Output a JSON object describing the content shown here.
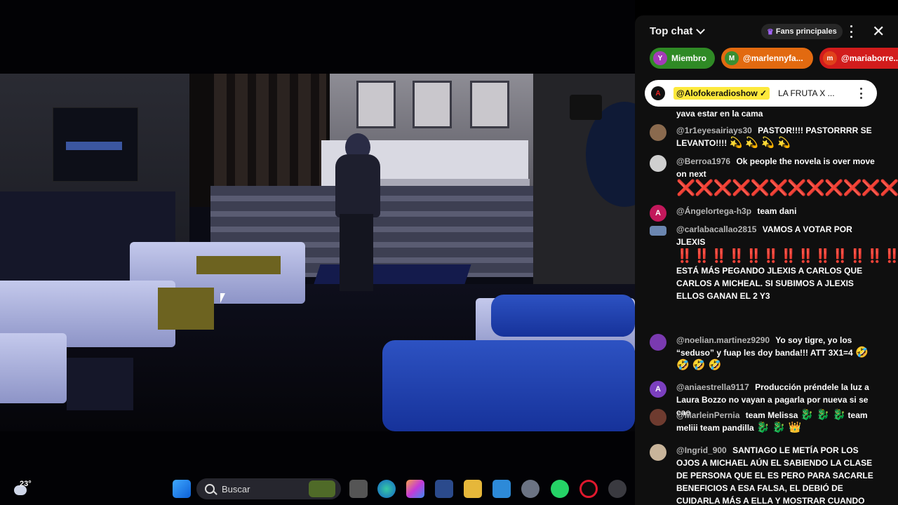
{
  "taskbar": {
    "temperature": "23°",
    "search_placeholder": "Buscar"
  },
  "chat": {
    "title": "Top chat",
    "fans_badge": "Fans principales",
    "chips": [
      {
        "initial": "Y",
        "label": "Miembro",
        "color": "#3a9a2c",
        "avatar_color": "#a43bb8"
      },
      {
        "initial": "M",
        "label": "@marlennyfa...",
        "color": "#e26a10",
        "avatar_color": "#3a8e31"
      },
      {
        "initial": "m",
        "label": "@mariaborre...",
        "color": "#d21c1c",
        "avatar_color": "#e0421b"
      }
    ],
    "pinned": {
      "author": "@Alofokeradioshow ✓",
      "message": "LA FRUTA X ..."
    },
    "messages": [
      {
        "author": "",
        "text": "yava estar en la cama"
      },
      {
        "author": "@1r1eyesairiays30",
        "text": "PASTOR!!!! PASTORRRR SE LEVANTO!!!!",
        "emoji": "💫 💫 💫 💫"
      },
      {
        "author": "@Berroa1976",
        "text": "Ok people the novela is over move on next",
        "crosses": "❌❌❌❌❌❌❌❌❌❌❌❌❌❌❌❌"
      },
      {
        "author": "@Ángelortega-h3p",
        "text": "team dani",
        "initial": "A"
      },
      {
        "author": "@carlabacallao2815",
        "text": "VAMOS A VOTAR POR JLEXIS",
        "bangs": "‼️‼️‼️‼️‼️‼️‼️‼️‼️‼️‼️‼️‼️‼️‼️‼️‼️‼️‼️‼️‼️‼️‼️‼️",
        "text2": "ESTÁ MÁS PEGANDO JLEXIS A CARLOS QUE CARLOS A MICHEAL. SI SUBIMOS A JLEXIS ELLOS GANAN EL 2 Y3"
      },
      {
        "author": "@noelian.martinez9290",
        "text": "Yo soy tigre, yo los “seduso” y fuap les doy banda!!! ATT 3X1=4",
        "emoji": "🤣 🤣 🤣 🤣"
      },
      {
        "author": "@aniaestrella9117",
        "text": "Producción préndele la luz a Laura Bozzo no vayan a pagarla por nueva si se cae",
        "initial": "A"
      },
      {
        "author": "@MarleinPernia",
        "text": "team Melissa",
        "emoji": "🐉 🐉 🐉",
        "text2": "team meliii team pandilla",
        "emoji2": "🐉 🐉 👑"
      },
      {
        "author": "@Ingrid_900",
        "text": "SANTIAGO LE METÍA POR LOS OJOS A MICHAEL AÚN EL SABIENDO LA CLASE DE PERSONA QUE EL ES PERO PARA SACARLE BENEFICIOS A ESA FALSA, EL DEBIÓ DE CUIDARLA MÁS A ELLA Y MOSTRAR CUANDO HABLABA MAL DE ELLA"
      }
    ]
  },
  "colors": {
    "chat_bg": "#0f0f0f",
    "pinned_highlight": "#fde93c",
    "accent_red": "#e02929"
  }
}
